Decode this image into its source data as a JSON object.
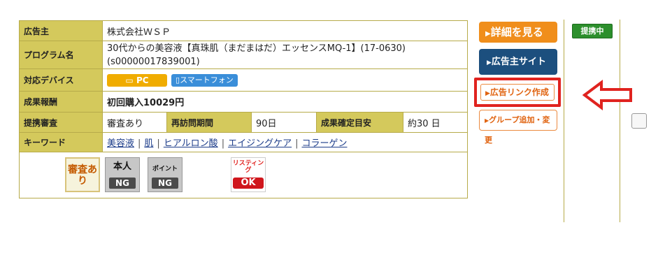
{
  "program": {
    "advertiser_label": "広告主",
    "advertiser_value": "株式会社ＷＳＰ",
    "name_label": "プログラム名",
    "name_line1": "30代からの美容液【真珠肌（まだまはだ）エッセンスMQ-1】(17-0630)",
    "name_line2": "(s00000017839001)",
    "device_label": "対応デバイス",
    "device_pc": "PC",
    "device_sp": "スマートフォン",
    "reward_label": "成果報酬",
    "reward_value": "初回購入10029円",
    "review_label": "提携審査",
    "review_value": "審査あり",
    "revisit_label": "再訪問期間",
    "revisit_value": "90日",
    "confirm_label": "成果確定目安",
    "confirm_value": "約30 日",
    "keyword_label": "キーワード",
    "keywords": [
      "美容液",
      "肌",
      "ヒアルロン酸",
      "エイジングケア",
      "コラーゲン"
    ],
    "keyword_sep": "|"
  },
  "badges": {
    "review": "審査あり",
    "self_title": "本人",
    "self_status": "NG",
    "point_title": "ポイント",
    "point_status": "NG",
    "listing_title": "リスティング",
    "listing_status": "OK"
  },
  "actions": {
    "detail": "詳細を見る",
    "advertiser_site": "広告主サイト",
    "create_link": "広告リンク作成",
    "group": "グループ追加・変更"
  },
  "status": "提携中",
  "colors": {
    "header_bg": "#d4c95c",
    "accent_orange": "#f08e1b",
    "navy": "#1c4f7e",
    "highlight_red": "#e0231f",
    "status_green": "#2c8f2c"
  }
}
